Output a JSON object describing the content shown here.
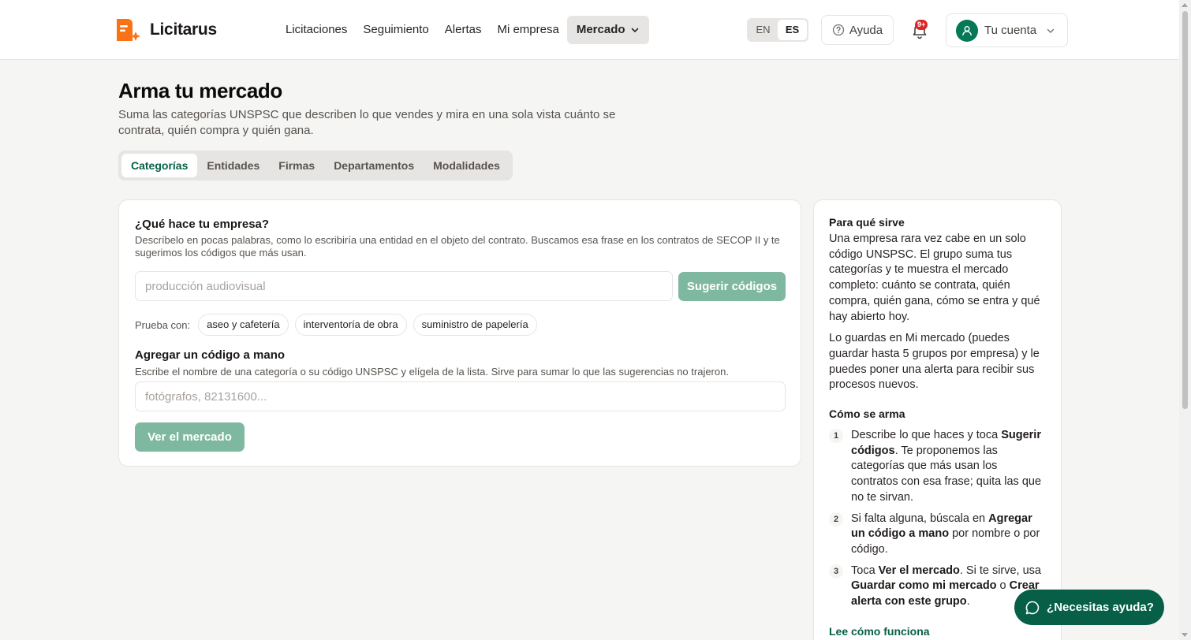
{
  "header": {
    "logo_text": "Licitarus",
    "nav": [
      {
        "label": "Licitaciones"
      },
      {
        "label": "Seguimiento"
      },
      {
        "label": "Alertas"
      },
      {
        "label": "Mi empresa"
      }
    ],
    "nav_active": "Mercado",
    "lang_en": "EN",
    "lang_es": "ES",
    "help_label": "Ayuda",
    "notif_badge": "9+",
    "account_label": "Tu cuenta",
    "icons": {
      "logo": "document-sparkle-icon",
      "help": "question-circle-icon",
      "bell": "bell-icon",
      "avatar": "user-icon",
      "chevron": "chevron-down-icon"
    }
  },
  "page": {
    "title": "Arma tu mercado",
    "subtitle": "Suma las categorías UNSPSC que describen lo que vendes y mira en una sola vista cuánto se contrata, quién compra y quién gana."
  },
  "tabs": [
    {
      "label": "Categorías",
      "active": true
    },
    {
      "label": "Entidades",
      "active": false
    },
    {
      "label": "Firmas",
      "active": false
    },
    {
      "label": "Departamentos",
      "active": false
    },
    {
      "label": "Modalidades",
      "active": false
    }
  ],
  "form": {
    "question_title": "¿Qué hace tu empresa?",
    "question_desc": "Descríbelo en pocas palabras, como lo escribiría una entidad en el objeto del contrato. Buscamos esa frase en los contratos de SECOP II y te sugerimos los códigos que más usan.",
    "desc_placeholder": "producción audiovisual",
    "desc_value": "",
    "suggest_button": "Sugerir códigos",
    "try_label": "Prueba con:",
    "chips": [
      "aseo y cafetería",
      "interventoría de obra",
      "suministro de papelería"
    ],
    "manual_title": "Agregar un código a mano",
    "manual_desc": "Escribe el nombre de una categoría o su código UNSPSC y elígela de la lista. Sirve para sumar lo que las sugerencias no trajeron.",
    "code_placeholder": "fotógrafos, 82131600...",
    "code_value": "",
    "view_button": "Ver el mercado"
  },
  "side": {
    "title1": "Para qué sirve",
    "p1": "Una empresa rara vez cabe en un solo código UNSPSC. El grupo suma tus categorías y te muestra el mercado completo: cuánto se contrata, quién compra, quién gana, cómo se entra y qué hay abierto hoy.",
    "p2": "Lo guardas en Mi mercado (puedes guardar hasta 5 grupos por empresa) y le puedes poner una alerta para recibir sus procesos nuevos.",
    "title2": "Cómo se arma",
    "steps": [
      {
        "num": "1",
        "a": "Describe lo que haces y toca ",
        "b": "Sugerir códigos",
        "c": ". Te proponemos las categorías que más usan los contratos con esa frase; quita las que no te sirvan."
      },
      {
        "num": "2",
        "a": "Si falta alguna, búscala en ",
        "b": "Agregar un código a mano",
        "c": " por nombre o por código."
      },
      {
        "num": "3",
        "a": "Toca ",
        "b": "Ver el mercado",
        "c": ". Si te sirve, usa ",
        "d": "Guardar como mi mercado",
        "e": " o ",
        "f": "Crear alerta con este grupo",
        "g": "."
      }
    ],
    "link": "Lee cómo funciona"
  },
  "float_help": "¿Necesitas ayuda?",
  "colors": {
    "brand": "#f97316",
    "accent": "#065f46",
    "button_disabled": "#7fb8a0",
    "badge": "#dc2626"
  }
}
